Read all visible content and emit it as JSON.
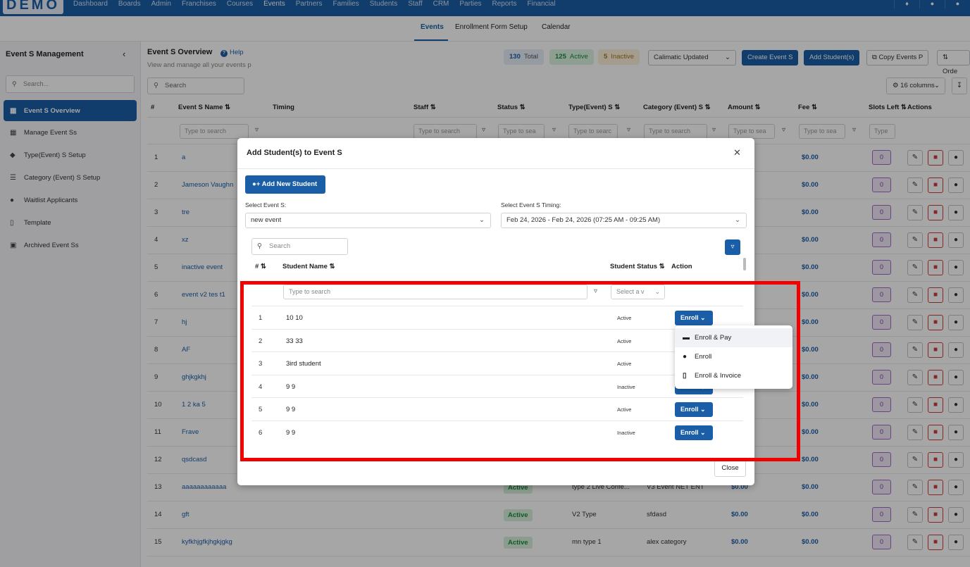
{
  "topnav": {
    "logo": "DEMO",
    "items": [
      "Dashboard",
      "Boards",
      "Admin",
      "Franchises",
      "Courses",
      "Events",
      "Partners",
      "Families",
      "Students",
      "Staff",
      "CRM",
      "Parties",
      "Reports",
      "Financial"
    ],
    "active": "Events"
  },
  "subnav": {
    "tabs": [
      "Events",
      "Enrollment Form Setup",
      "Calendar"
    ],
    "active": "Events"
  },
  "sidebar": {
    "title": "Event S Management",
    "search_placeholder": "Search...",
    "items": [
      {
        "label": "Event S Overview",
        "icon": "calendar-icon"
      },
      {
        "label": "Manage Event Ss",
        "icon": "calendar-plus-icon"
      },
      {
        "label": "Type(Event) S Setup",
        "icon": "tags-icon"
      },
      {
        "label": "Category (Event) S Setup",
        "icon": "layers-icon"
      },
      {
        "label": "Waitlist Applicants",
        "icon": "user-clock-icon"
      },
      {
        "label": "Template",
        "icon": "file-icon"
      },
      {
        "label": "Archived Event Ss",
        "icon": "archive-icon"
      }
    ]
  },
  "page": {
    "title": "Event S Overview",
    "help": "Help",
    "subtitle": "View and manage all your events p",
    "stats": {
      "total": "130",
      "total_label": "Total",
      "active": "125",
      "active_label": "Active",
      "inactive": "5",
      "inactive_label": "Inactive"
    },
    "select_value": "Calimatic Updated",
    "create_btn": "Create Event S",
    "add_students_btn": "Add Student(s)",
    "copy_btn": "Copy Events P",
    "order_btn": "Orde",
    "search_placeholder": "Search",
    "columns_btn": "16 columns"
  },
  "table": {
    "headers": [
      "#",
      "Event S Name",
      "Timing",
      "Staff",
      "Status",
      "Type(Event) S",
      "Category (Event) S",
      "Amount",
      "Fee",
      "Slots Left",
      "Actions"
    ],
    "filter_placeholders": [
      "Type to search",
      "Type to search",
      "Type to sea",
      "Type to searc",
      "Type to search",
      "Type to sea",
      "Type to sea",
      "Type"
    ],
    "rows": [
      {
        "n": "1",
        "name": "a",
        "status": "",
        "type": "",
        "category": "",
        "amount": "",
        "fee": "$0.00",
        "slots": "0"
      },
      {
        "n": "2",
        "name": "Jameson Vaughn",
        "status": "",
        "type": "",
        "category": "",
        "amount": "",
        "fee": "$0.00",
        "slots": "0"
      },
      {
        "n": "3",
        "name": "tre",
        "status": "",
        "type": "",
        "category": "",
        "amount": "",
        "fee": "$0.00",
        "slots": "0"
      },
      {
        "n": "4",
        "name": "xz",
        "status": "",
        "type": "",
        "category": "",
        "amount": "",
        "fee": "$0.00",
        "slots": "0"
      },
      {
        "n": "5",
        "name": "inactive event",
        "status": "",
        "type": "",
        "category": "",
        "amount": "",
        "fee": "$0.00",
        "slots": "0"
      },
      {
        "n": "6",
        "name": "event v2 tes t1",
        "status": "",
        "type": "",
        "category": "",
        "amount": "",
        "fee": "$0.00",
        "slots": "0"
      },
      {
        "n": "7",
        "name": "hj",
        "status": "",
        "type": "",
        "category": "",
        "amount": "",
        "fee": "$0.00",
        "slots": "0"
      },
      {
        "n": "8",
        "name": "AF",
        "status": "",
        "type": "",
        "category": "",
        "amount": "",
        "fee": "$0.00",
        "slots": "0"
      },
      {
        "n": "9",
        "name": "ghjkgkhj",
        "status": "",
        "type": "",
        "category": "",
        "amount": "",
        "fee": "$0.00",
        "slots": "0"
      },
      {
        "n": "10",
        "name": "1 2 ka 5",
        "status": "",
        "type": "",
        "category": "",
        "amount": "",
        "fee": "$0.00",
        "slots": "0"
      },
      {
        "n": "11",
        "name": "Frave",
        "status": "",
        "type": "",
        "category": "",
        "amount": "",
        "fee": "$0.00",
        "slots": "0"
      },
      {
        "n": "12",
        "name": "qsdcasd",
        "status": "",
        "type": "",
        "category": "",
        "amount": "",
        "fee": "$0.00",
        "slots": "0"
      },
      {
        "n": "13",
        "name": "aaaaaaaaaaaa",
        "status": "Active",
        "type": "type 2 Live Confe...",
        "category": "V3 Event NET ENT",
        "amount": "$0.00",
        "fee": "$0.00",
        "slots": "0"
      },
      {
        "n": "14",
        "name": "gft",
        "status": "Active",
        "type": "V2 Type",
        "category": "sfdasd",
        "amount": "$0.00",
        "fee": "$0.00",
        "slots": "0"
      },
      {
        "n": "15",
        "name": "kyfkhjgfkjhgkjgkg",
        "status": "Active",
        "type": "mn type 1",
        "category": "alex category",
        "amount": "$0.00",
        "fee": "$0.00",
        "slots": "0"
      }
    ]
  },
  "modal": {
    "title": "Add Student(s) to Event S",
    "add_new_btn": "Add New Student",
    "event_label": "Select Event S:",
    "event_value": "new event",
    "timing_label": "Select Event S Timing:",
    "timing_value": "Feb 24, 2026 - Feb 24, 2026 (07:25 AM - 09:25 AM)",
    "search_placeholder": "Search",
    "headers": {
      "num": "#",
      "name": "Student Name",
      "status": "Student Status",
      "action": "Action"
    },
    "name_filter_placeholder": "Type to search",
    "status_filter_placeholder": "Select a v",
    "enroll_label": "Enroll",
    "students": [
      {
        "n": "1",
        "name": "10 10",
        "status": "Active"
      },
      {
        "n": "2",
        "name": "33 33",
        "status": "Active"
      },
      {
        "n": "3",
        "name": "3ird student",
        "status": "Active"
      },
      {
        "n": "4",
        "name": "9 9",
        "status": "Inactive"
      },
      {
        "n": "5",
        "name": "9 9",
        "status": "Active"
      },
      {
        "n": "6",
        "name": "9 9",
        "status": "Inactive"
      }
    ],
    "close_btn": "Close"
  },
  "dropdown": {
    "items": [
      {
        "label": "Enroll & Pay",
        "icon": "credit-card-icon"
      },
      {
        "label": "Enroll",
        "icon": "user-plus-icon"
      },
      {
        "label": "Enroll & Invoice",
        "icon": "invoice-icon"
      }
    ]
  },
  "colors": {
    "primary": "#1b5ea8",
    "highlight": "#f20000"
  }
}
